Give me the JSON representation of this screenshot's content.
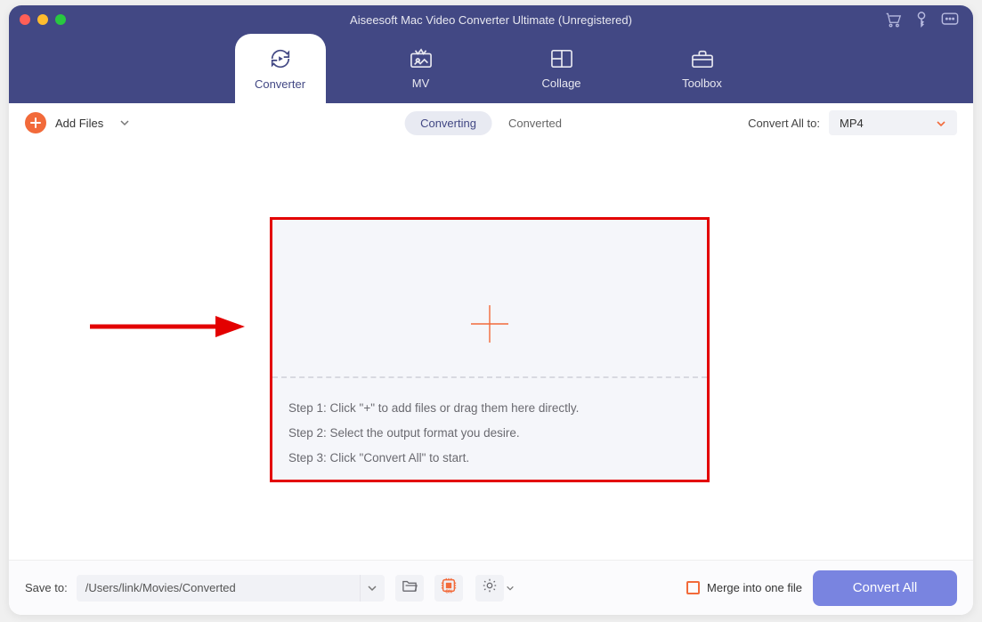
{
  "colors": {
    "header_bg": "#424884",
    "accent_orange": "#f26a3a",
    "primary_button": "#7984e0",
    "highlight_border": "#e30000"
  },
  "window": {
    "title": "Aiseesoft Mac Video Converter Ultimate (Unregistered)"
  },
  "tabs": [
    {
      "id": "converter",
      "label": "Converter",
      "icon": "refresh-play-icon",
      "active": true
    },
    {
      "id": "mv",
      "label": "MV",
      "icon": "mv-icon",
      "active": false
    },
    {
      "id": "collage",
      "label": "Collage",
      "icon": "collage-icon",
      "active": false
    },
    {
      "id": "toolbox",
      "label": "Toolbox",
      "icon": "toolbox-icon",
      "active": false
    }
  ],
  "toolbar": {
    "add_files_label": "Add Files",
    "segmented": {
      "converting": "Converting",
      "converted": "Converted",
      "active": "converting"
    },
    "convert_all_to_label": "Convert All to:",
    "format_selected": "MP4"
  },
  "dropzone": {
    "steps": [
      "Step 1: Click \"+\" to add files or drag them here directly.",
      "Step 2: Select the output format you desire.",
      "Step 3: Click \"Convert All\" to start."
    ]
  },
  "bottom": {
    "save_to_label": "Save to:",
    "save_path": "/Users/link/Movies/Converted",
    "merge_label": "Merge into one file",
    "merge_checked": false,
    "convert_all_btn": "Convert All"
  },
  "titlebar_icons": [
    "cart-icon",
    "key-icon",
    "chat-icon"
  ]
}
